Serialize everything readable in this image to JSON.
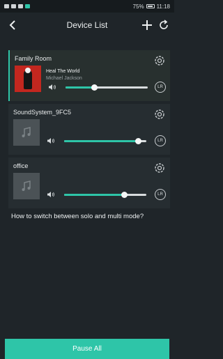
{
  "status_bar": {
    "right_text": "75%",
    "time": "11:18"
  },
  "header": {
    "title": "Device List"
  },
  "devices": [
    {
      "name": "Family Room",
      "track_title": "Heal The World",
      "track_artist": "Michael Jackson",
      "volume_fraction": 0.35,
      "channel": "LR",
      "active": true
    },
    {
      "name": "SoundSystem_9FC5",
      "volume_fraction": 0.9,
      "channel": "LR",
      "active": false
    },
    {
      "name": "office",
      "volume_fraction": 0.73,
      "channel": "LR",
      "active": false
    }
  ],
  "help": {
    "text": "How to switch between solo and multi mode?"
  },
  "footer": {
    "pause_all_label": "Pause All"
  },
  "colors": {
    "accent": "#2ec5a8",
    "background": "#1f2529",
    "card": "#262d31"
  }
}
